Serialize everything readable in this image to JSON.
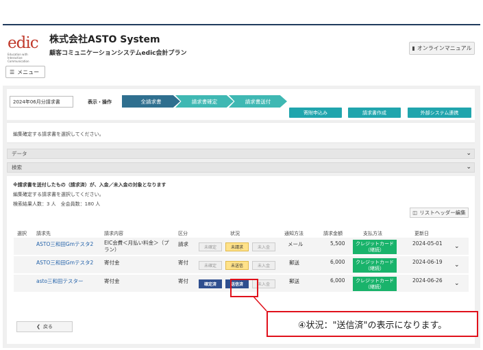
{
  "header": {
    "logo_word": "edic",
    "logo_sub": "Education with Interactive Communication",
    "company": "株式会社ASTO System",
    "system_name": "顧客コミュニケーションシステムedic会計プラン",
    "manual_label": "オンラインマニュアル",
    "menu_label": "メニュー"
  },
  "toolbar": {
    "month": "2024年06月分請求書",
    "op_label": "表示・操作",
    "steps": [
      "全請求書",
      "請求書確定",
      "請求書送付"
    ],
    "actions": [
      "寄附申込み",
      "請求書作成",
      "外部システム連携"
    ]
  },
  "message": "編集確定する請求書を選択してください。",
  "accordions": {
    "data": "データ",
    "search": "検索"
  },
  "panel": {
    "note_bold": "※請求書を送付したもの（請求済）が、入金／未入金の対象となります",
    "note": "編集確定する請求書を選択してください。",
    "count": "検索結果人数：3 人　全会員数：180 人",
    "header_edit": "リストヘッダー編集",
    "back": "戻る"
  },
  "table": {
    "headers": [
      "選択",
      "請求先",
      "請求内容",
      "区分",
      "状況",
      "通知方法",
      "請求金額",
      "支払方法",
      "更新日"
    ],
    "rows": [
      {
        "name": "ASTO三和田Gmテスタ2",
        "content": "EIC会費＜月払い料金＞（プラン）",
        "kubun": "請求",
        "status": [
          "未確定",
          "未請求",
          "未入金"
        ],
        "notify": "メール",
        "amount": "5,500",
        "payment": "クレジットカード（継続）",
        "updated": "2024-05-01"
      },
      {
        "name": "ASTO三和田Gmテスタ2",
        "content": "寄付金",
        "kubun": "寄付",
        "status": [
          "未確定",
          "未送信",
          "未入金"
        ],
        "notify": "郵送",
        "amount": "6,000",
        "payment": "クレジットカード（継続）",
        "updated": "2024-06-19"
      },
      {
        "name": "asto三和田テスター",
        "content": "寄付金",
        "kubun": "寄付",
        "status": [
          "確定済",
          "送信済",
          "未入金"
        ],
        "notify": "郵送",
        "amount": "6,000",
        "payment": "クレジットカード（継続）",
        "updated": "2024-06-26"
      }
    ]
  },
  "callout": "④状況：\"送信済\"の表示になります。",
  "colors": {
    "step_active": "#2f6f8f",
    "step": "#3fb8b3",
    "action": "#20a5ad",
    "payment_badge": "#19b36b",
    "highlight": "#e0101a"
  }
}
